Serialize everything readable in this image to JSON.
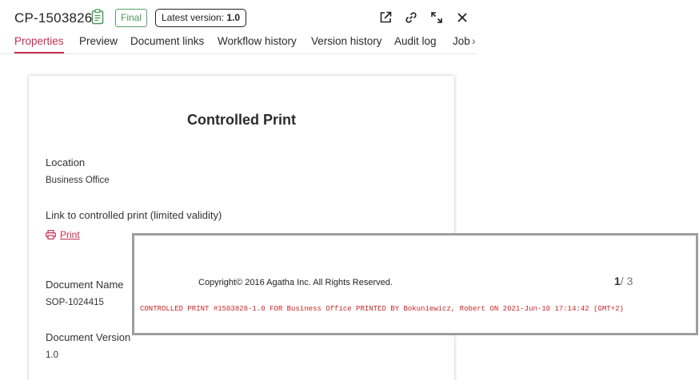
{
  "header": {
    "doc_id": "CP-1503826",
    "status": "Final",
    "version_label": "Latest version:",
    "version_value": "1.0",
    "icons": [
      "clipboard-icon",
      "open-external-icon",
      "link-icon",
      "expand-icon",
      "close-icon"
    ]
  },
  "tabs": [
    {
      "label": "Properties",
      "active": true
    },
    {
      "label": "Preview"
    },
    {
      "label": "Document links"
    },
    {
      "label": "Workflow history"
    },
    {
      "label": "Version history"
    },
    {
      "label": "Audit log"
    },
    {
      "label": "Job"
    }
  ],
  "document": {
    "title": "Controlled Print",
    "fields": [
      {
        "label": "Location",
        "value": "Business Office"
      },
      {
        "label": "Link to controlled print (limited validity)",
        "value": "Print"
      },
      {
        "label": "Document Name",
        "value": "SOP-1024415"
      },
      {
        "label": "Document Version",
        "value": "1.0"
      }
    ]
  },
  "overlay": {
    "copyright": "Copyright© 2016 Agatha Inc. All Rights Reserved.",
    "page_current": "1",
    "page_total": "/ 3",
    "controlled_print_line": "CONTROLLED PRINT #1503828-1.0 FOR Business Office PRINTED BY Bokuniewicz, Robert ON 2021-Jun-10 17:14:42 (GMT+2)"
  },
  "colors": {
    "accent": "#c33052",
    "status_green": "#4b9a5b",
    "controlled_red": "#c62828"
  }
}
